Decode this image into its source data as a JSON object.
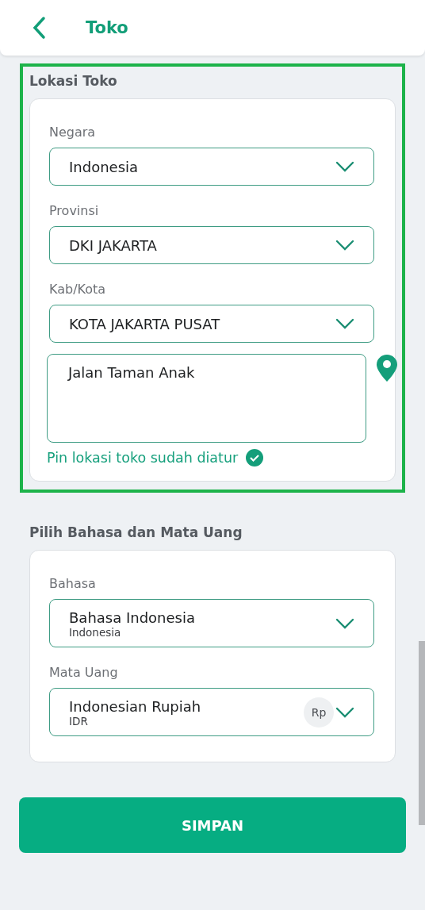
{
  "header": {
    "title": "Toko"
  },
  "sections": [
    {
      "title": "Lokasi Toko",
      "highlighted": true,
      "fields": [
        {
          "kind": "select",
          "label": "Negara",
          "value": "Indonesia"
        },
        {
          "kind": "select",
          "label": "Provinsi",
          "value": "DKI JAKARTA"
        },
        {
          "kind": "select",
          "label": "Kab/Kota",
          "value": "KOTA JAKARTA PUSAT"
        },
        {
          "kind": "address",
          "value": "Jalan Taman Anak",
          "status": "Pin lokasi toko sudah diatur",
          "confirmed": true
        }
      ]
    },
    {
      "title": "Pilih Bahasa dan Mata Uang",
      "highlighted": false,
      "fields": [
        {
          "kind": "select",
          "label": "Bahasa",
          "value": "Bahasa Indonesia",
          "sub": "Indonesia"
        },
        {
          "kind": "select",
          "label": "Mata Uang",
          "value": "Indonesian Rupiah",
          "sub": "IDR",
          "badge": "Rp"
        }
      ]
    }
  ],
  "save_button": "SIMPAN"
}
